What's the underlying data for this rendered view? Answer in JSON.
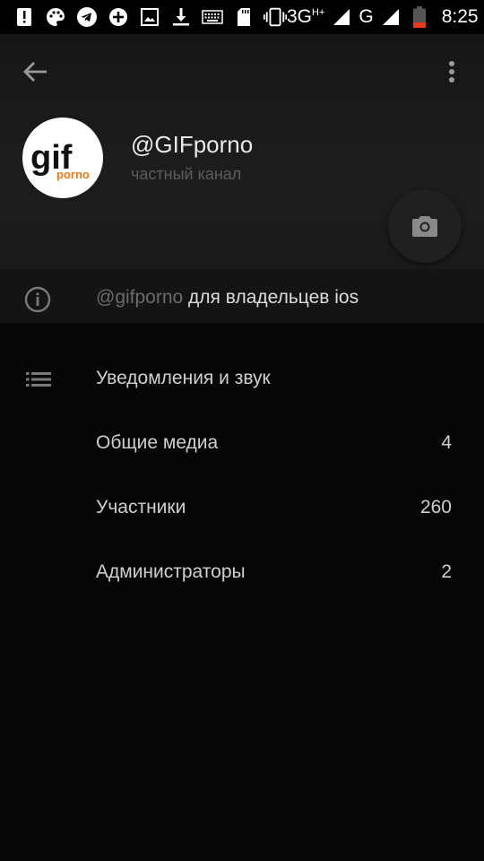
{
  "status_bar": {
    "network": "3G",
    "network_sup": "H+",
    "network2": "G",
    "time": "8:25"
  },
  "channel": {
    "name": "@GIFporno",
    "type": "частный канал",
    "logo_main": "gif",
    "logo_sub": "porno"
  },
  "info": {
    "link": "@gifporno",
    "text": " для владельцев ios"
  },
  "menu": {
    "notifications": "Уведомления и звук",
    "items": [
      {
        "label": "Общие медиа",
        "count": "4"
      },
      {
        "label": "Участники",
        "count": "260"
      },
      {
        "label": "Администраторы",
        "count": "2"
      }
    ]
  }
}
